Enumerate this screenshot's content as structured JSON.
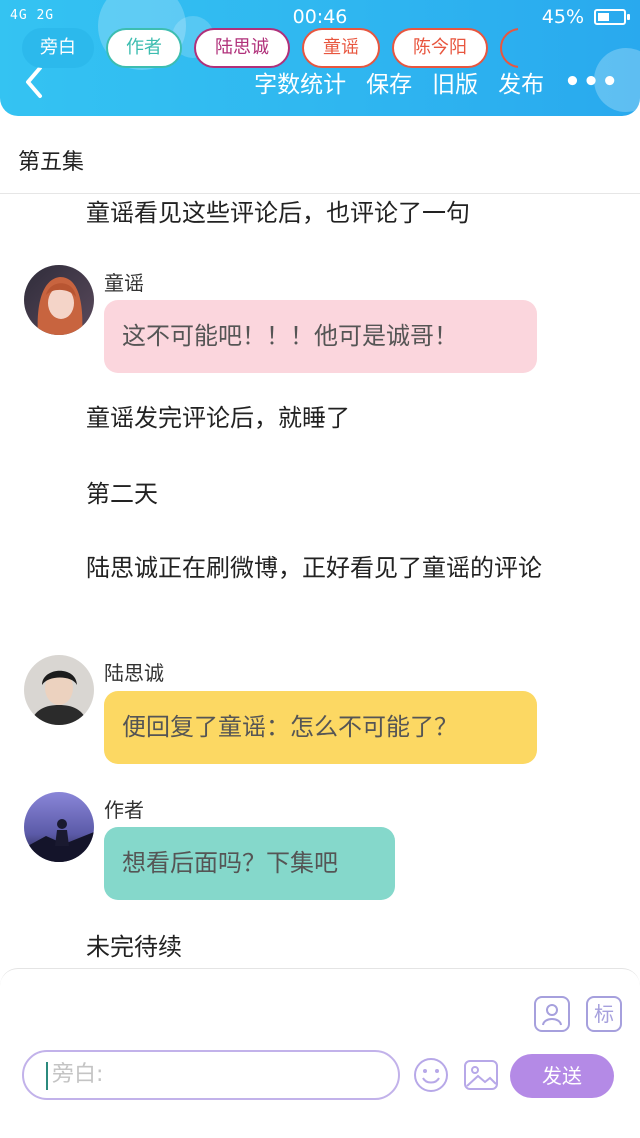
{
  "status_bar": {
    "signal": "4G 2G",
    "time": "00:46",
    "battery": "45%",
    "battery_level": 0.45
  },
  "header": {
    "back_icon": "chevron-left-icon",
    "actions": [
      "字数统计",
      "保存",
      "旧版",
      "发布"
    ],
    "more_icon": "more-icon",
    "more_label": "•••",
    "background": "#2fb6f0"
  },
  "chapter_title": "第五集",
  "story": {
    "p1": "童谣看见这些评论后，也评论了一句",
    "msg1": {
      "speaker": "童谣",
      "text": "这不可能吧！！！他可是诚哥！",
      "color": "#fbd6dd"
    },
    "p2": "童谣发完评论后，就睡了",
    "p3": "第二天",
    "p4": "陆思诚正在刷微博，正好看见了童谣的评论",
    "msg2": {
      "speaker": "陆思诚",
      "text": "便回复了童谣：怎么不可能了？",
      "color": "#fcd863"
    },
    "msg3": {
      "speaker": "作者",
      "text": "想看后面吗？下集吧",
      "color": "#85d8cb"
    },
    "p5": "未完待续"
  },
  "composer": {
    "chips": [
      {
        "label": "旁白",
        "color": "#2cb9ec",
        "active": true
      },
      {
        "label": "作者",
        "color": "#3dbdb0",
        "active": false
      },
      {
        "label": "陆思诚",
        "color": "#b0307a",
        "active": false
      },
      {
        "label": "童谣",
        "color": "#e8563f",
        "active": false
      },
      {
        "label": "陈今阳",
        "color": "#e8563f",
        "active": false
      }
    ],
    "tool_icons": [
      "person-card-icon",
      "tag-icon"
    ],
    "tag_label": "标",
    "input_placeholder": "旁白:",
    "emoji_icon": "emoji-icon",
    "image_icon": "image-icon",
    "send_label": "发送",
    "accent": "#b48ae6"
  }
}
